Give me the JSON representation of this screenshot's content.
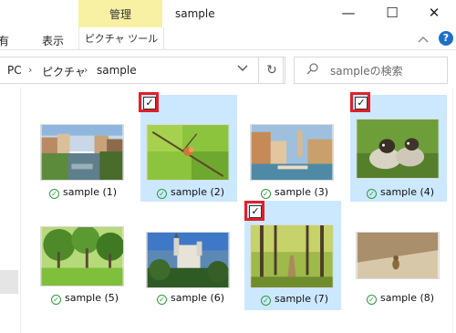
{
  "window": {
    "context_tab": "管理",
    "title": "sample",
    "minimize": "—",
    "maximize": "☐",
    "close": "✕"
  },
  "ribbon": {
    "tab_share": "共有",
    "tab_view": "表示",
    "tab_picture_tools": "ピクチャ ツール",
    "collapse_icon": "chevron-up",
    "help": "?"
  },
  "address": {
    "crumbs": [
      "PC",
      "ピクチャ",
      "sample"
    ],
    "separator": "›",
    "dropdown": "⌄",
    "refresh": "↻"
  },
  "search": {
    "placeholder": "sampleの検索",
    "icon": "⌕"
  },
  "items": [
    {
      "label": "sample (1)",
      "selected": false
    },
    {
      "label": "sample (2)",
      "selected": true
    },
    {
      "label": "sample (3)",
      "selected": false
    },
    {
      "label": "sample (4)",
      "selected": true
    },
    {
      "label": "sample (5)",
      "selected": false
    },
    {
      "label": "sample (6)",
      "selected": false
    },
    {
      "label": "sample (7)",
      "selected": true
    },
    {
      "label": "sample (8)",
      "selected": false
    }
  ],
  "check_mark": "✓",
  "sync_mark": "✓"
}
